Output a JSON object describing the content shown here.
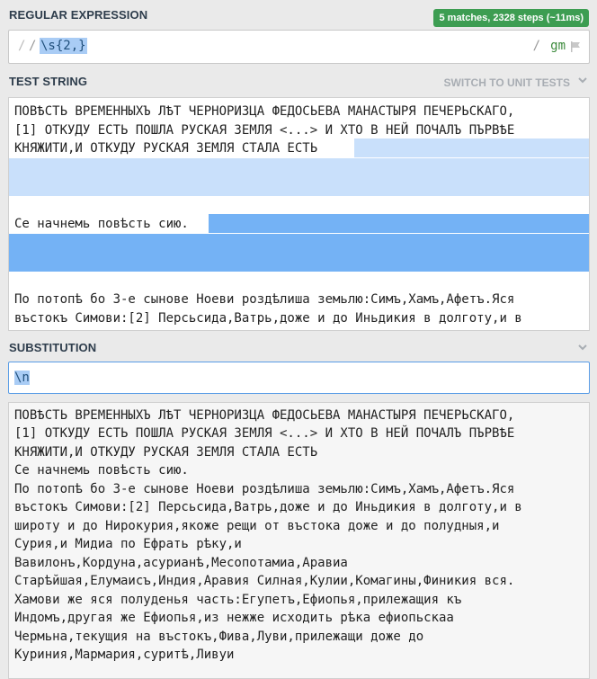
{
  "regex_section": {
    "title": "REGULAR EXPRESSION",
    "match_info": "5 matches, 2328 steps (~11ms)",
    "open_delimiter": "/",
    "pattern": "\\s{2,}",
    "close_delimiter": "/",
    "flags": "gm",
    "flag_icon": "flag-icon"
  },
  "test_section": {
    "title": "TEST STRING",
    "switch_label": "SWITCH TO UNIT TESTS",
    "lines": [
      "ПОВѢСТЬ ВРЕМЕННЫХЪ ЛѢТ ЧЕРНОРИЗЦА ФЕДОСЬЕВА МАНАСТЫРЯ ПЕЧЕРЬСКАГО,",
      "[1] ОТКУДУ ЕСТЬ ПОШЛА РУСКАЯ ЗЕМЛЯ <...> И ХТО В НЕЙ ПОЧАЛЪ ПЪРВѢЕ",
      "КНЯЖИТИ,И ОТКУДУ РУСКАЯ ЗЕМЛЯ СТАЛА ЕСТЬ",
      "",
      "",
      "",
      "Се начнемь повѣсть сию.",
      "",
      "",
      "",
      "По потопѣ бо 3-е сынове Ноеви роздѣлиша земьлю:Симъ,Хамъ,Афетъ.Яся",
      "въстокъ Симови:[2] Персьсида,Ватрь,доже и до Иньдикия в долготу,и в"
    ]
  },
  "substitution_section": {
    "title": "SUBSTITUTION",
    "value": "\\n",
    "result_lines": [
      "ПОВѢСТЬ ВРЕМЕННЫХЪ ЛѢТ ЧЕРНОРИЗЦА ФЕДОСЬЕВА МАНАСТЫРЯ ПЕЧЕРЬСКАГО,",
      "[1] ОТКУДУ ЕСТЬ ПОШЛА РУСКАЯ ЗЕМЛЯ <...> И ХТО В НЕЙ ПОЧАЛЪ ПЪРВѢЕ",
      "КНЯЖИТИ,И ОТКУДУ РУСКАЯ ЗЕМЛЯ СТАЛА ЕСТЬ",
      "Се начнемь повѣсть сию.",
      "По потопѣ бо 3-е сынове Ноеви роздѣлиша земьлю:Симъ,Хамъ,Афетъ.Яся",
      "въстокъ Симови:[2] Персьсида,Ватрь,доже и до Иньдикия в долготу,и в",
      "широту и до Нирокурия,якоже рещи от въстока доже и до полудныя,и",
      "Сурия,и Мидиа по Ефрать рѣку,и",
      "Вавилонъ,Кордуна,асурианѣ,Месопотамиа,Аравиа",
      "Старѣйшая,Елумаисъ,Индия,Аравия Силная,Кулии,Комагины,Финикия вся.",
      "Хамови же яся полуденья часть:Егупетъ,Ефиопья,прилежащия къ",
      "Индомъ,другая же Ефиопья,из нежже исходить рѣка ефиопьскаа",
      "Чермьна,текущия на въстокъ,Фива,Луви,прилежащи доже до",
      "Куриния,Мармария,суритѣ,Ливуи"
    ]
  }
}
